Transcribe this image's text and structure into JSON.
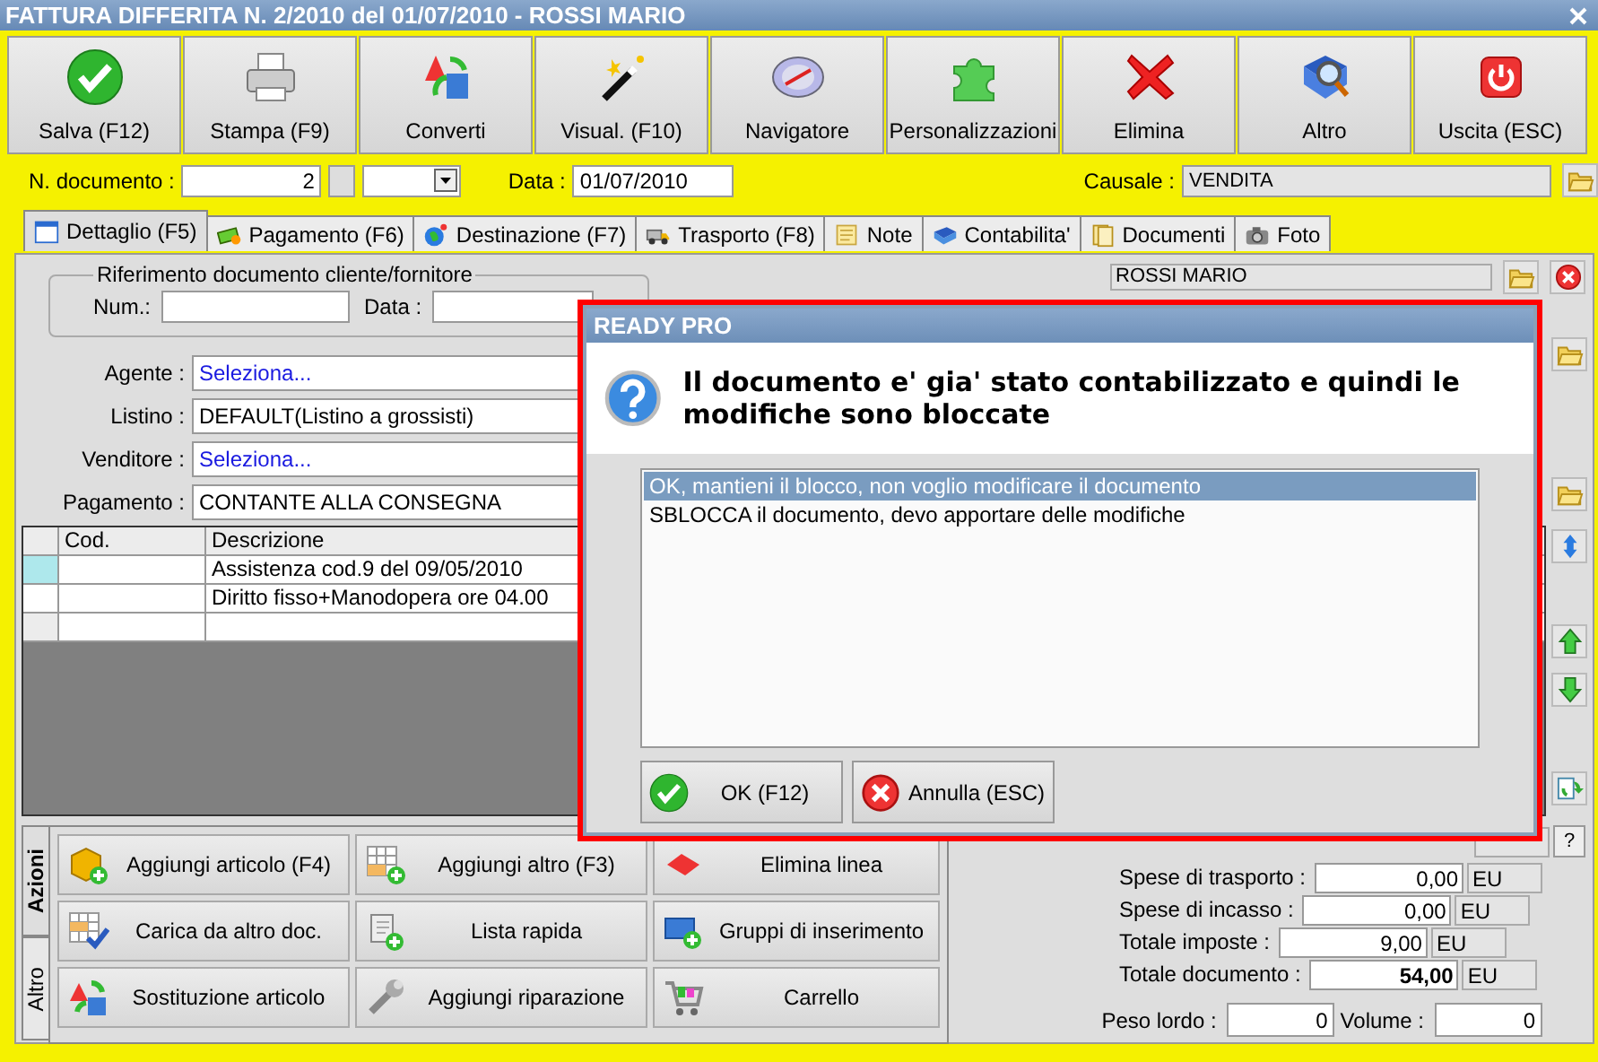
{
  "window": {
    "title": "FATTURA DIFFERITA N. 2/2010 del 01/07/2010 - ROSSI MARIO"
  },
  "toolbar": [
    "Salva (F12)",
    "Stampa (F9)",
    "Converti",
    "Visual. (F10)",
    "Navigatore",
    "Personalizzazioni",
    "Elimina",
    "Altro",
    "Uscita (ESC)"
  ],
  "document": {
    "number_label": "N. documento :",
    "number": "2",
    "date_label": "Data :",
    "date": "01/07/2010",
    "causale_label": "Causale :",
    "causale": "VENDITA"
  },
  "tabs": [
    {
      "label": "Dettaglio (F5)",
      "selected": true
    },
    {
      "label": "Pagamento (F6)",
      "selected": false
    },
    {
      "label": "Destinazione (F7)",
      "selected": false
    },
    {
      "label": "Trasporto (F8)",
      "selected": false
    },
    {
      "label": "Note",
      "selected": false
    },
    {
      "label": "Contabilita'",
      "selected": false
    },
    {
      "label": "Documenti",
      "selected": false
    },
    {
      "label": "Foto",
      "selected": false
    }
  ],
  "reference": {
    "legend": "Riferimento documento cliente/fornitore",
    "num_label": "Num.:",
    "date_label": "Data :"
  },
  "fields": [
    {
      "label": "Agente :",
      "value": "Seleziona...",
      "kind": "link"
    },
    {
      "label": "Listino :",
      "value": "DEFAULT(Listino a grossisti)",
      "kind": "text"
    },
    {
      "label": "Venditore :",
      "value": "Seleziona...",
      "kind": "link"
    },
    {
      "label": "Pagamento :",
      "value": "CONTANTE ALLA CONSEGNA",
      "kind": "dropdown"
    }
  ],
  "customer": "ROSSI MARIO",
  "grid": {
    "columns": [
      "Cod.",
      "Descrizione"
    ],
    "rows": [
      {
        "cod": "",
        "descrizione": "Assistenza cod.9 del 09/05/2010",
        "selected": true
      },
      {
        "cod": "",
        "descrizione": "Diritto fisso+Manodopera ore 04.00",
        "selected": false
      }
    ]
  },
  "side_tabs": [
    {
      "label": "Azioni",
      "selected": true
    },
    {
      "label": "Altro",
      "selected": false
    }
  ],
  "actions": [
    "Aggiungi articolo (F4)",
    "Aggiungi altro (F3)",
    "Elimina linea",
    "Carica da altro doc.",
    "Lista rapida",
    "Gruppi di inserimento",
    "Sostituzione articolo",
    "Aggiungi riparazione",
    "Carrello"
  ],
  "help_button": "?",
  "totals": [
    {
      "label": "Spese di trasporto :",
      "value": "0,00",
      "unit": "EU",
      "emphasis": false
    },
    {
      "label": "Spese di incasso :",
      "value": "0,00",
      "unit": "EU",
      "emphasis": false
    },
    {
      "label": "Totale imposte :",
      "value": "9,00",
      "unit": "EU",
      "emphasis": false
    },
    {
      "label": "Totale documento :",
      "value": "54,00",
      "unit": "EU",
      "emphasis": true
    }
  ],
  "weights": [
    {
      "label": "Peso lordo :",
      "value": "0"
    },
    {
      "label": "Volume :",
      "value": "0"
    }
  ],
  "dialog": {
    "title": "READY PRO",
    "message": "Il documento e' gia' stato contabilizzato e quindi le modifiche sono bloccate",
    "options": [
      {
        "label": "OK, mantieni il blocco, non voglio modificare il documento",
        "selected": true
      },
      {
        "label": "SBLOCCA il documento, devo apportare delle modifiche",
        "selected": false
      }
    ],
    "buttons": [
      "OK (F12)",
      "Annulla (ESC)"
    ]
  }
}
